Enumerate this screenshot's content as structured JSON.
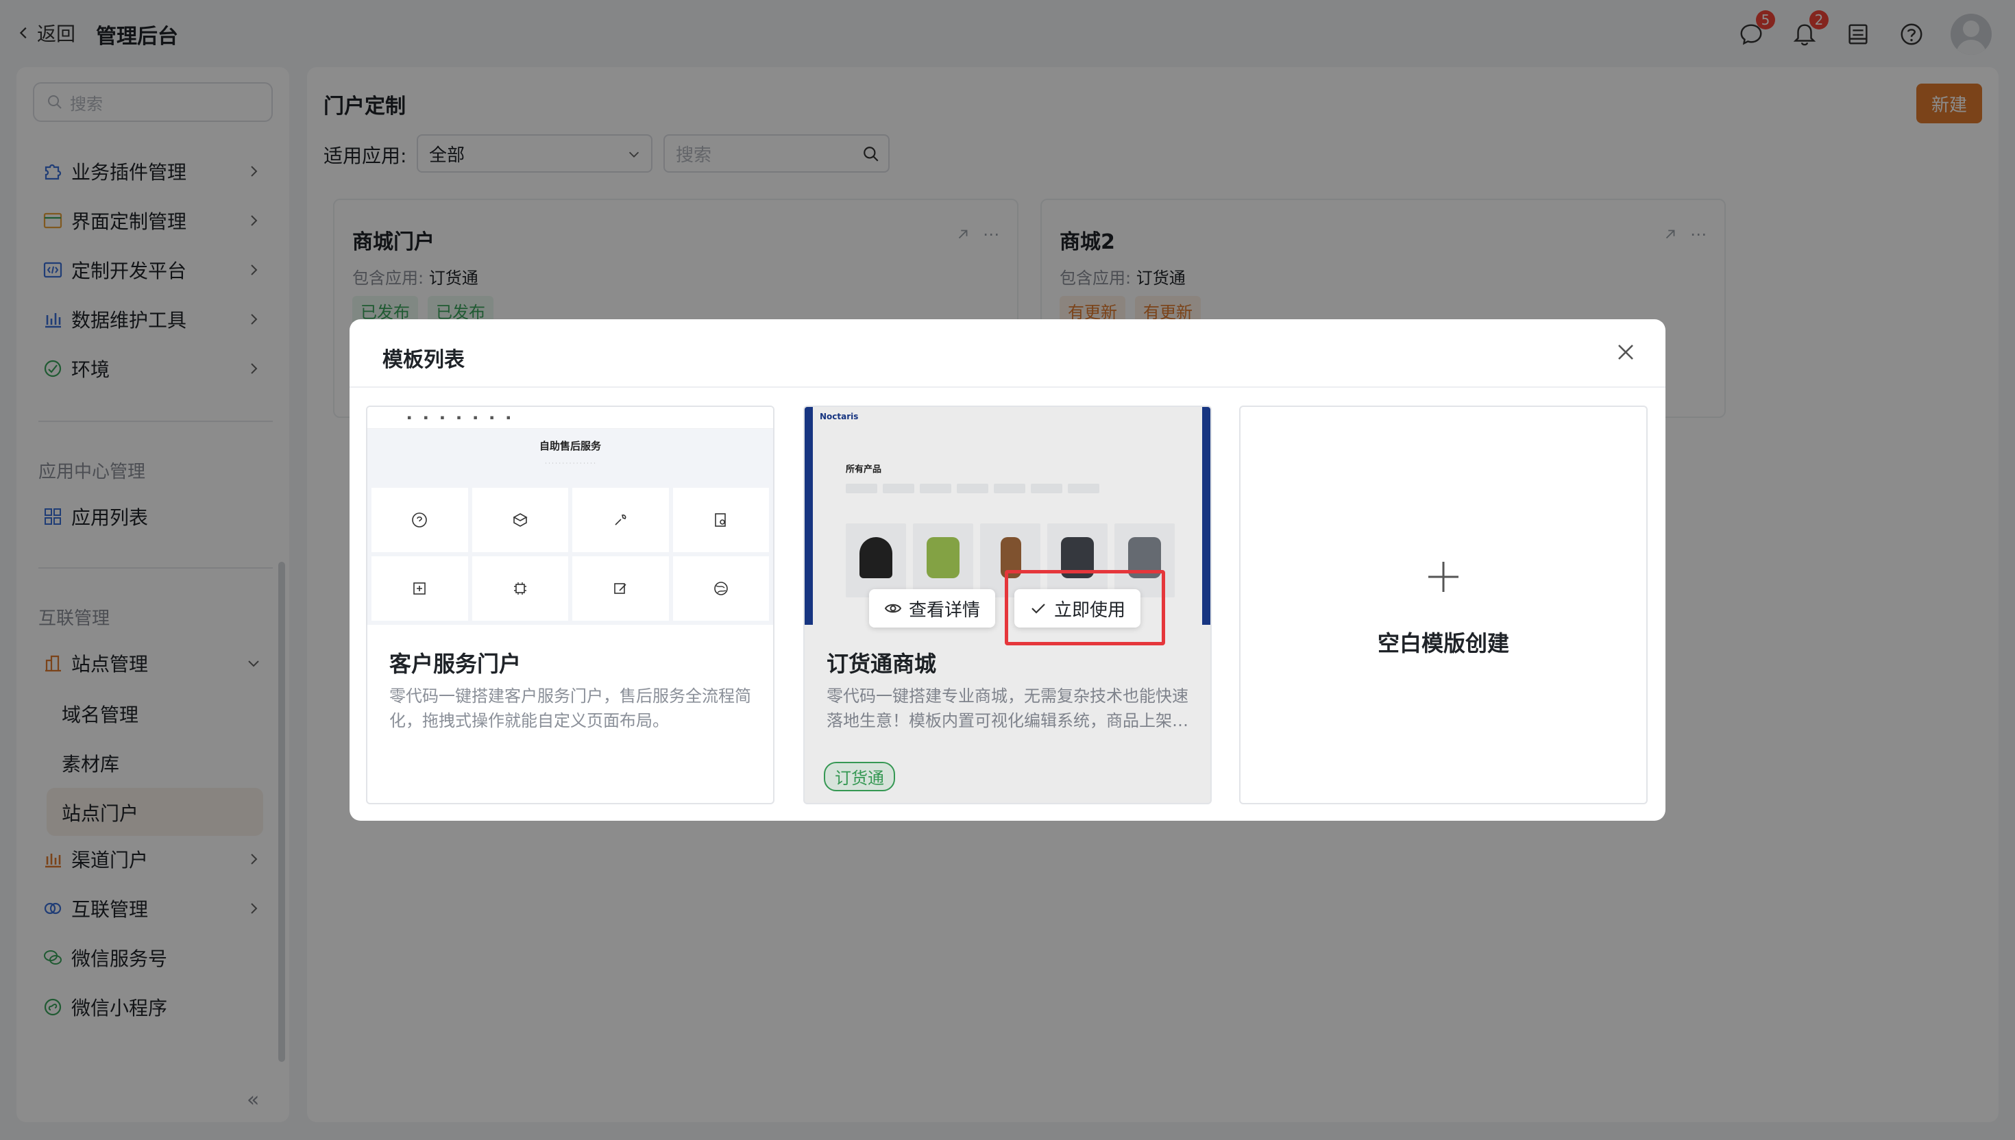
{
  "topbar": {
    "back_label": "返回",
    "app_title": "管理后台",
    "message_badge": "5",
    "notification_badge": "2"
  },
  "sidebar": {
    "search_placeholder": "搜索",
    "items": [
      {
        "label": "业务插件管理",
        "icon": "puzzle-icon"
      },
      {
        "label": "界面定制管理",
        "icon": "window-icon"
      },
      {
        "label": "定制开发平台",
        "icon": "code-icon"
      },
      {
        "label": "数据维护工具",
        "icon": "bar-chart-icon"
      },
      {
        "label": "环境",
        "icon": "environment-icon"
      }
    ],
    "section_app_center": "应用中心管理",
    "app_list": "应用列表",
    "section_interconnect": "互联管理",
    "site_management": "站点管理",
    "sub_items": [
      "域名管理",
      "素材库",
      "站点门户"
    ],
    "more_items": [
      {
        "label": "渠道门户",
        "icon": "channel-icon"
      },
      {
        "label": "互联管理",
        "icon": "link-icon"
      },
      {
        "label": "微信服务号",
        "icon": "wechat-icon"
      },
      {
        "label": "微信小程序",
        "icon": "miniprogram-icon"
      }
    ],
    "collapse_glyph": "«"
  },
  "main": {
    "title": "门户定制",
    "new_button": "新建",
    "filter_label": "适用应用:",
    "filter_value": "全部",
    "search_placeholder": "搜索",
    "cards": [
      {
        "title": "商城门户",
        "apps_label": "包含应用:",
        "apps_value": "订货通",
        "tags": [
          "已发布",
          "已发布"
        ]
      },
      {
        "title": "商城2",
        "apps_label": "包含应用:",
        "apps_value": "订货通",
        "tags": [
          "有更新",
          "有更新"
        ]
      }
    ]
  },
  "modal": {
    "title": "模板列表",
    "templates": [
      {
        "name": "客户服务门户",
        "desc": "零代码一键搭建客户服务门户，售后服务全流程简化，拖拽式操作就能自定义页面布局。",
        "thumb_title": "自助售后服务"
      },
      {
        "name": "订货通商城",
        "desc": "零代码一键搭建专业商城，无需复杂技术也能快速落地生意！模板内置可视化编辑系统，商品上架…",
        "tag": "订货通",
        "thumb_brand": "Noctaris",
        "thumb_heading": "所有产品",
        "view_button": "查看详情",
        "use_button": "立即使用"
      }
    ],
    "blank_label": "空白模版创建"
  },
  "colors": {
    "accent": "#e07a2e",
    "highlight": "#e5363b",
    "success": "#3aa55b"
  }
}
